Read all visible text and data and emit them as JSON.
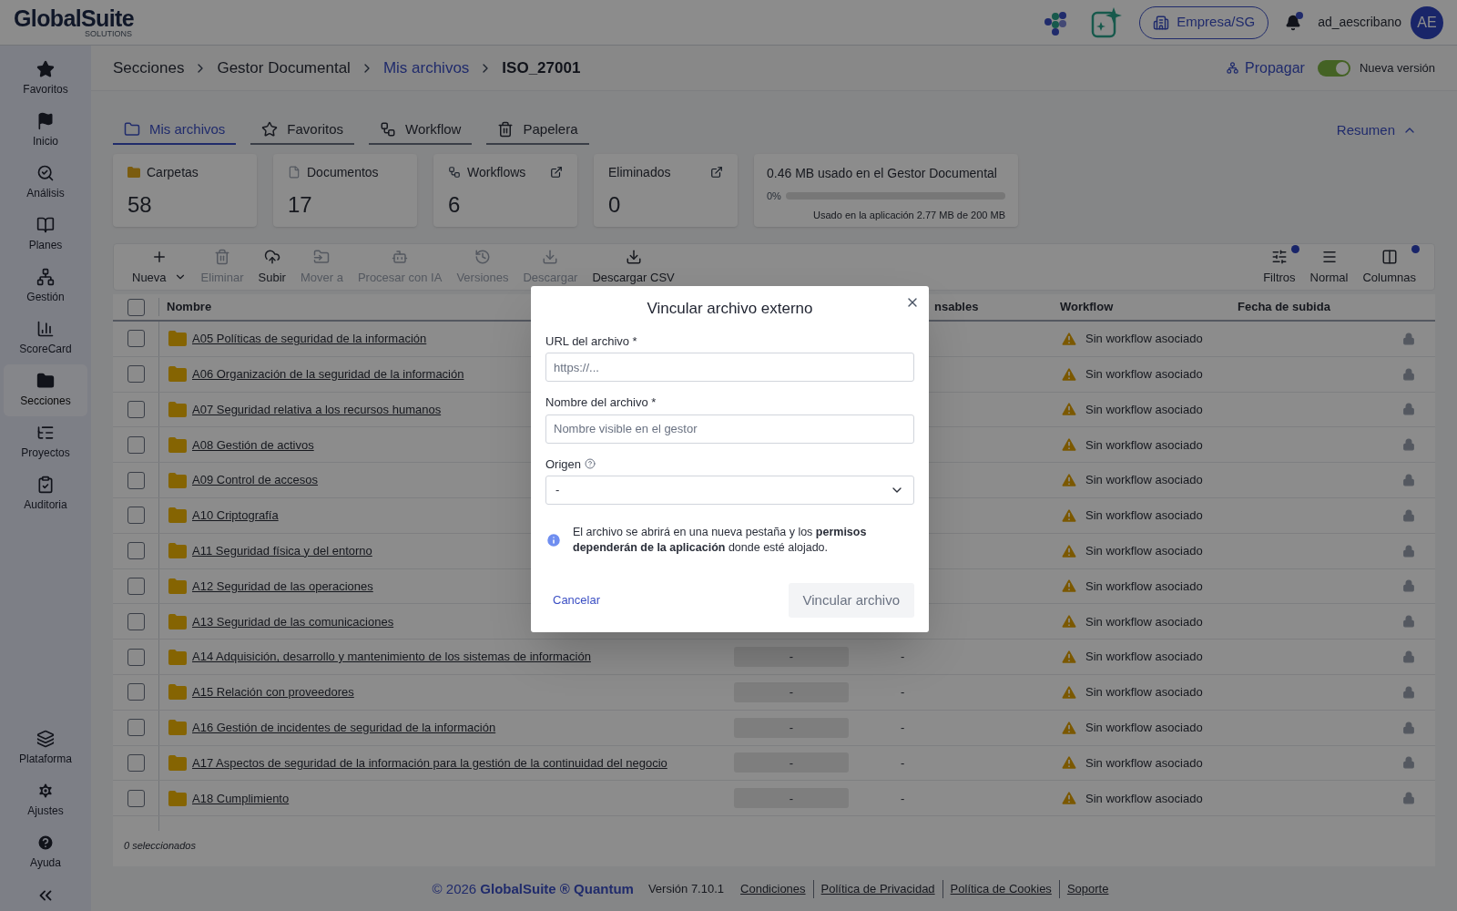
{
  "header": {
    "logo": "GlobalSuite",
    "logo_sub": "SOLUTIONS",
    "company": "Empresa/SG",
    "notifications": true,
    "username": "ad_aescribano",
    "avatar": "AE"
  },
  "sidebar": {
    "items": [
      {
        "label": "Favoritos",
        "selected": false
      },
      {
        "label": "Inicio",
        "selected": false
      },
      {
        "label": "Análisis",
        "selected": false
      },
      {
        "label": "Planes",
        "selected": false
      },
      {
        "label": "Gestión",
        "selected": false
      },
      {
        "label": "ScoreCard",
        "selected": false
      },
      {
        "label": "Secciones",
        "selected": true
      },
      {
        "label": "Proyectos",
        "selected": false
      },
      {
        "label": "Auditoria",
        "selected": false
      }
    ],
    "bottom_items": [
      {
        "label": "Plataforma"
      },
      {
        "label": "Ajustes"
      },
      {
        "label": "Ayuda"
      }
    ]
  },
  "breadcrumb": [
    {
      "label": "Secciones",
      "kind": "plain"
    },
    {
      "label": "Gestor Documental",
      "kind": "plain"
    },
    {
      "label": "Mis archivos",
      "kind": "link"
    },
    {
      "label": "ISO_27001",
      "kind": "current"
    }
  ],
  "propagate": "Propagar",
  "new_version": {
    "label": "Nueva versión",
    "on": true
  },
  "tabs": [
    {
      "label": "Mis archivos",
      "selected": true
    },
    {
      "label": "Favoritos",
      "selected": false
    },
    {
      "label": "Workflow",
      "selected": false
    },
    {
      "label": "Papelera",
      "selected": false
    }
  ],
  "summary_toggle": {
    "label": "Resumen",
    "expanded": true
  },
  "stats": [
    {
      "label": "Carpetas",
      "value": "58",
      "external": false
    },
    {
      "label": "Documentos",
      "value": "17",
      "external": false
    },
    {
      "label": "Workflows",
      "value": "6",
      "external": true
    },
    {
      "label": "Eliminados",
      "value": "0",
      "external": true
    }
  ],
  "storage": {
    "title": "0.46 MB usado en el Gestor Documental",
    "percent": "0%",
    "level": 0,
    "note": "Usado en la aplicación 2.77 MB de 200 MB"
  },
  "toolbar": [
    {
      "label": "Nueva",
      "disabled": false,
      "dropdown": true
    },
    {
      "label": "Eliminar",
      "disabled": true
    },
    {
      "label": "Subir",
      "disabled": false
    },
    {
      "label": "Mover a",
      "disabled": true
    },
    {
      "label": "Procesar con IA",
      "disabled": true
    },
    {
      "label": "Versiones",
      "disabled": true
    },
    {
      "label": "Descargar",
      "disabled": true
    },
    {
      "label": "Descargar CSV",
      "disabled": false
    }
  ],
  "view_tools": [
    {
      "label": "Filtros",
      "badge": true
    },
    {
      "label": "Normal",
      "badge": false
    },
    {
      "label": "Columnas",
      "badge": true
    }
  ],
  "table": {
    "select_all": {
      "checked": false
    },
    "columns": [
      "Nombre",
      "nsables",
      "Workflow",
      "Fecha de subida"
    ],
    "rows": [
      {
        "checked": false,
        "name": "A05 Políticas de seguridad de la información",
        "workflow": "Sin workflow asociado",
        "locked": true
      },
      {
        "checked": false,
        "name": "A06 Organización de la seguridad de la información",
        "workflow": "Sin workflow asociado",
        "locked": true
      },
      {
        "checked": false,
        "name": "A07 Seguridad relativa a los recursos humanos",
        "workflow": "Sin workflow asociado",
        "locked": true
      },
      {
        "checked": false,
        "name": "A08 Gestión de activos",
        "workflow": "Sin workflow asociado",
        "locked": true
      },
      {
        "checked": false,
        "name": "A09 Control de accesos",
        "workflow": "Sin workflow asociado",
        "locked": true
      },
      {
        "checked": false,
        "name": "A10 Criptografía",
        "workflow": "Sin workflow asociado",
        "locked": true
      },
      {
        "checked": false,
        "name": "A11 Seguridad física y del entorno",
        "workflow": "Sin workflow asociado",
        "locked": true
      },
      {
        "checked": false,
        "name": "A12 Seguridad de las operaciones",
        "workflow": "Sin workflow asociado",
        "locked": true
      },
      {
        "checked": false,
        "name": "A13 Seguridad de las comunicaciones",
        "workflow": "Sin workflow asociado",
        "locked": true
      },
      {
        "checked": false,
        "name": "A14 Adquisición, desarrollo y mantenimiento de los sistemas de información",
        "column_3": "-",
        "responsables": "-",
        "workflow": "Sin workflow asociado",
        "locked": true
      },
      {
        "checked": false,
        "name": "A15 Relación con proveedores",
        "column_3": "-",
        "responsables": "-",
        "workflow": "Sin workflow asociado",
        "locked": true
      },
      {
        "checked": false,
        "name": "A16 Gestión de incidentes de seguridad de la información",
        "column_3": "-",
        "responsables": "-",
        "workflow": "Sin workflow asociado",
        "locked": true
      },
      {
        "checked": false,
        "name": "A17 Aspectos de seguridad de la información para la gestión de la continuidad del negocio",
        "column_3": "-",
        "responsables": "-",
        "workflow": "Sin workflow asociado",
        "locked": true
      },
      {
        "checked": false,
        "name": "A18 Cumplimiento",
        "column_3": "-",
        "responsables": "-",
        "workflow": "Sin workflow asociado",
        "locked": true
      }
    ],
    "selection": "0 seleccionados"
  },
  "footer": {
    "copyright": "© 2026 **GlobalSuite ® Quantum**",
    "version": "Versión 7.10.1",
    "links": [
      "Condiciones",
      "Política de Privacidad",
      "Política de Cookies",
      "Soporte"
    ]
  },
  "modal": {
    "title": "Vincular archivo externo",
    "fields": [
      {
        "kind": "text",
        "label": "URL del archivo *",
        "placeholder": "https://..."
      },
      {
        "kind": "text",
        "label": "Nombre del archivo *",
        "placeholder": "Nombre visible en el gestor"
      },
      {
        "kind": "select",
        "label": "Origen",
        "help": true,
        "value": "-"
      }
    ],
    "info": "El archivo se abrirá en una nueva pestaña y los **permisos dependerán de la aplicación** donde esté alojado.",
    "cancel": "Cancelar",
    "submit": {
      "label": "Vincular archivo",
      "disabled": true
    }
  }
}
